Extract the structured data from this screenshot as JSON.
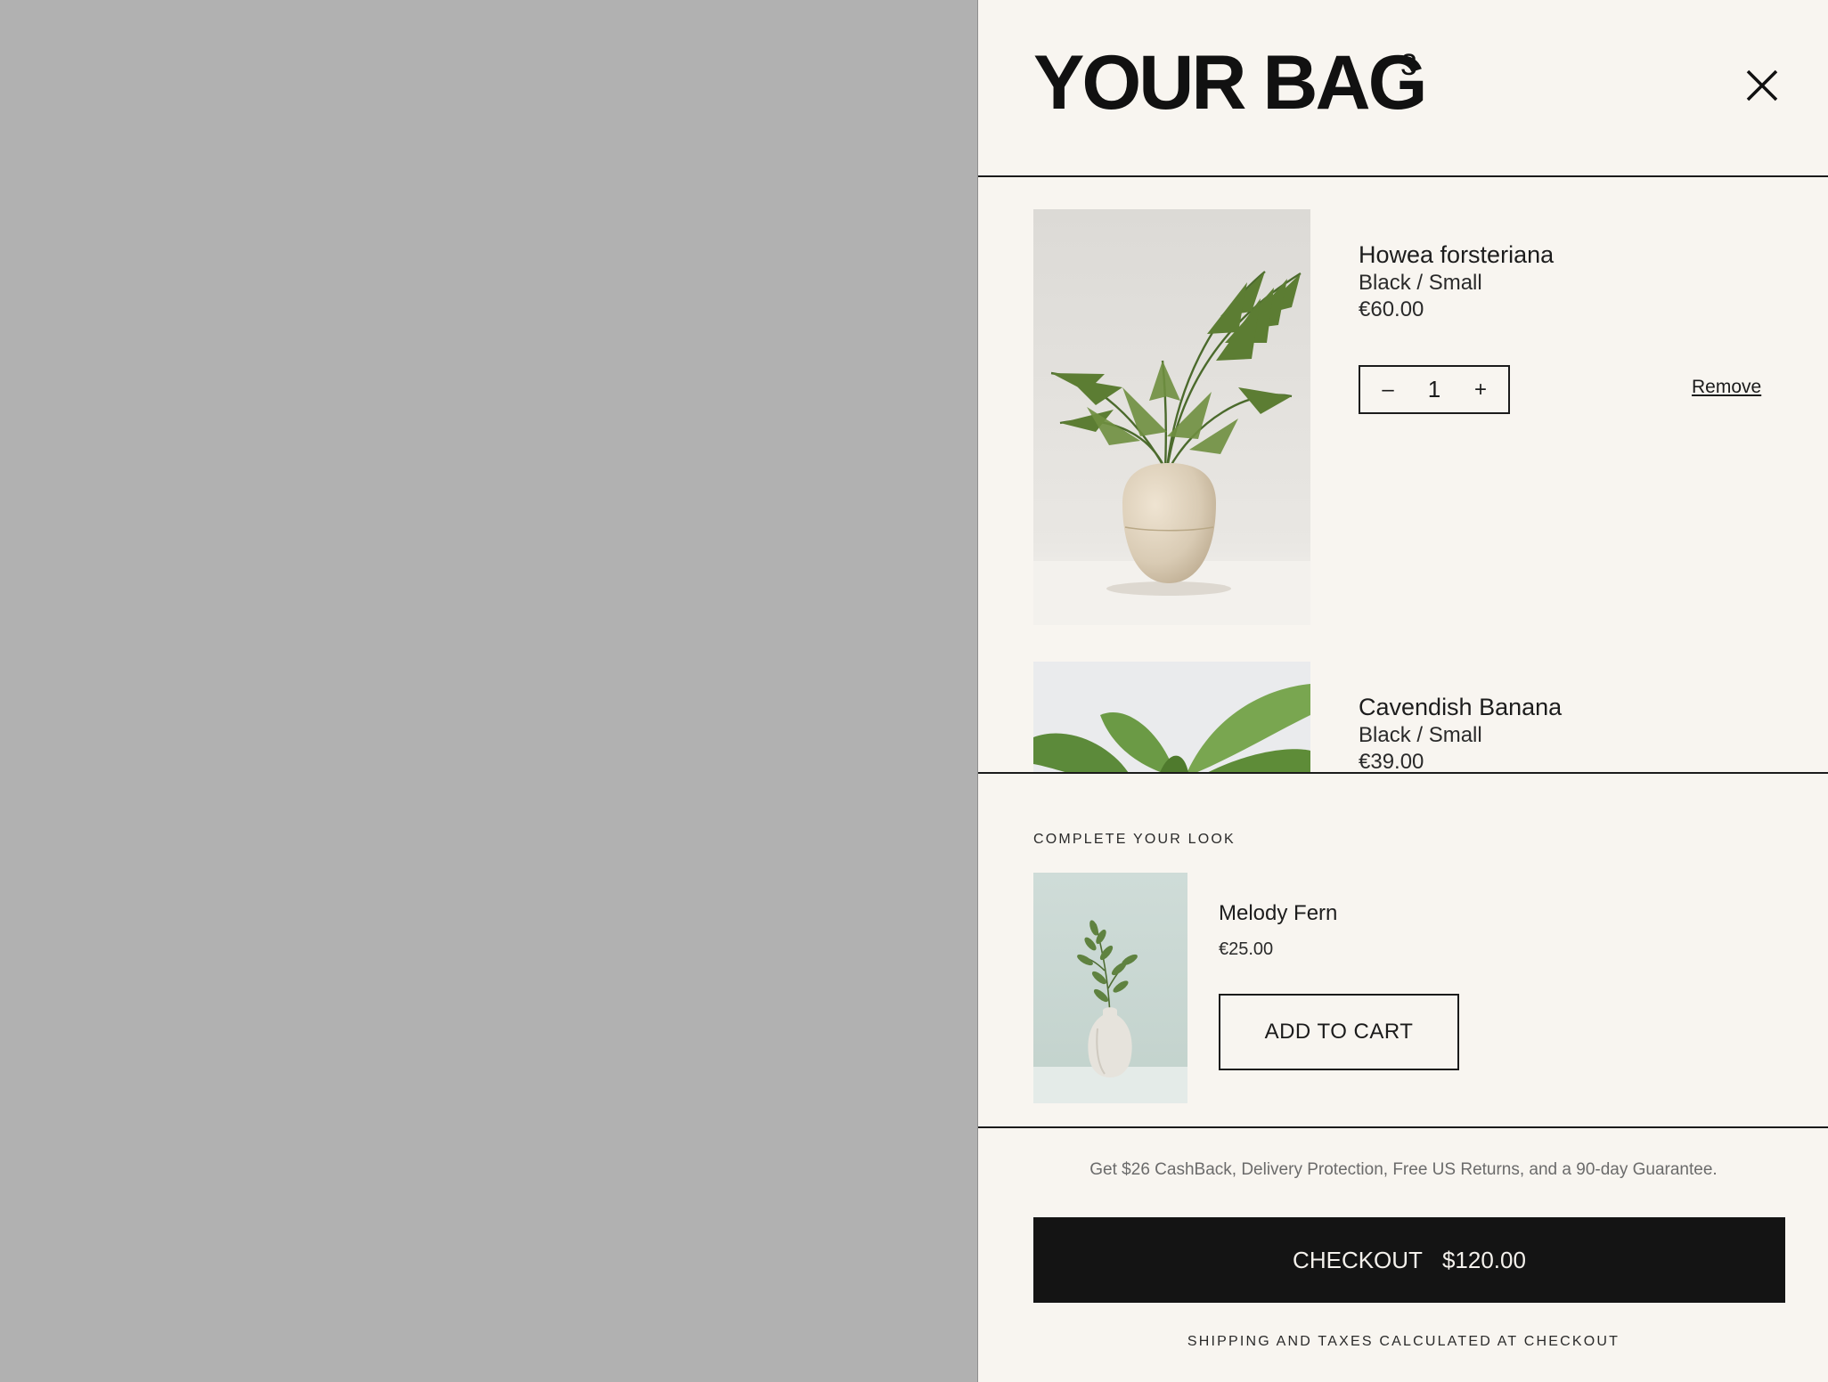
{
  "bag": {
    "title": "YOUR BAG",
    "count": "3",
    "close_icon": "close-icon"
  },
  "items": [
    {
      "name": "Howea forsteriana",
      "variant": "Black / Small",
      "price": "€60.00",
      "quantity": "1",
      "decrease_icon": "minus-icon",
      "increase_icon": "plus-icon",
      "remove_label": "Remove"
    },
    {
      "name": "Cavendish Banana",
      "variant": "Black / Small",
      "price": "€39.00"
    }
  ],
  "upsell": {
    "heading": "COMPLETE YOUR LOOK",
    "product": {
      "name": "Melody Fern",
      "price": "€25.00",
      "button_label": "ADD TO CART"
    }
  },
  "footer": {
    "note": "Get $26 CashBack, Delivery Protection, Free US Returns, and a 90-day Guarantee.",
    "checkout_label": "CHECKOUT",
    "checkout_total": "$120.00",
    "shipping_note": "SHIPPING AND TAXES CALCULATED AT CHECKOUT"
  },
  "colors": {
    "overlay": "#b1b1b1",
    "drawer_bg": "#f8f5f0",
    "checkout_bg": "#141414",
    "divider": "#1b1b1b"
  }
}
